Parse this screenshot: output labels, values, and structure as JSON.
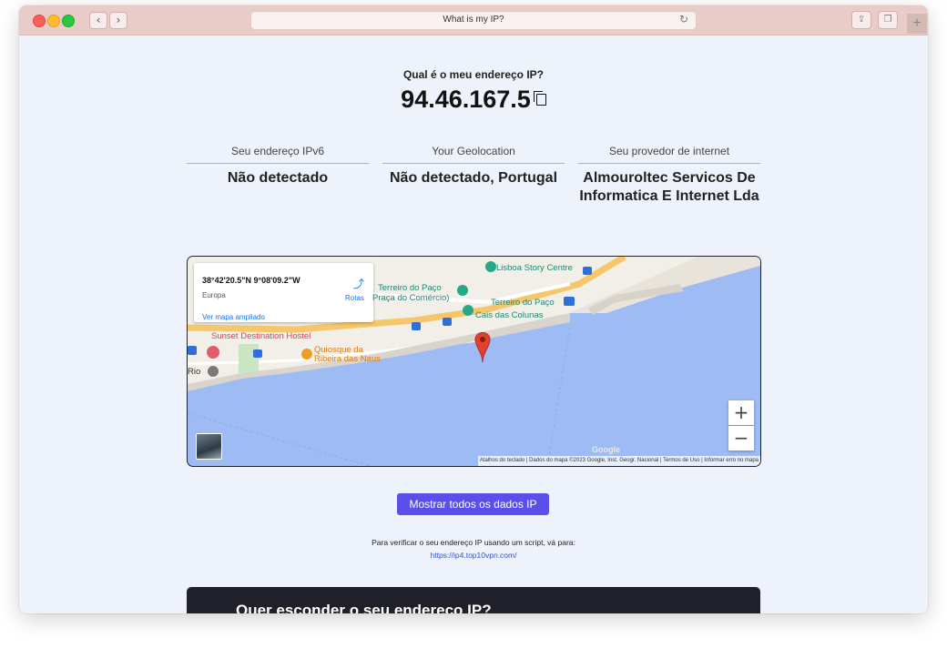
{
  "browser": {
    "url_title": "What is my IP?",
    "reload_icon": "reload-icon",
    "back_icon": "chevron-left-icon",
    "forward_icon": "chevron-right-icon"
  },
  "page": {
    "question": "Qual é o meu endereço IP?",
    "ip": "94.46.167.5",
    "columns": [
      {
        "label": "Seu endereço IPv6",
        "value": "Não detectado"
      },
      {
        "label": "Your Geolocation",
        "value": "Não detectado, Portugal"
      },
      {
        "label": "Seu provedor de internet",
        "value": "Almouroltec Servicos De Informatica E Internet Lda"
      }
    ],
    "cta_label": "Mostrar todos os dados IP",
    "hint_text": "Para verificar o seu endereço IP usando um script, vá para:",
    "hint_link": "https://ip4.top10vpn.com/",
    "dark_title": "Quer esconder o seu endereço IP?"
  },
  "map": {
    "coords": "38°42'20.5\"N 9°08'09.2\"W",
    "region": "Europa",
    "larger_map": "Ver mapa ampliado",
    "directions": "Rotas",
    "places": {
      "lisboa_story": "Lisboa Story Centre",
      "terreiro_paco": "Terreiro do Paço",
      "praca_comercio": "Praça do Comércio)",
      "terreiro_metro": "Terreiro do Paço",
      "cais_colunas": "Cais das Colunas",
      "sunset_hostel": "Sunset Destination Hostel",
      "quiosque_1": "Quiosque da",
      "quiosque_2": "Ribeira das Naus",
      "rio": "Rio"
    },
    "zoom_in": "+",
    "zoom_out": "−",
    "google": "Google",
    "attribution": "Atalhos do teclado | Dados do mapa ©2023 Google, Inst. Geogr. Nacional | Termos de Uso | Informar erro no mapa"
  }
}
